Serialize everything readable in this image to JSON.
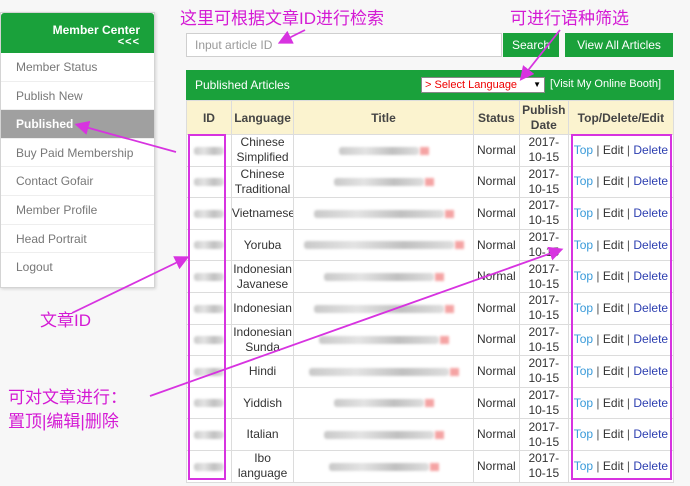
{
  "sidebar": {
    "title": "Member Center",
    "collapse": "<<<",
    "items": [
      {
        "label": "Member Status"
      },
      {
        "label": "Publish New"
      },
      {
        "label": "Published"
      },
      {
        "label": "Buy Paid Membership"
      },
      {
        "label": "Contact Gofair"
      },
      {
        "label": "Member Profile"
      },
      {
        "label": "Head Portrait"
      },
      {
        "label": "Logout"
      }
    ]
  },
  "search": {
    "placeholder": "Input article ID",
    "search_label": "Search",
    "view_all_label": "View All Articles"
  },
  "panel": {
    "title": "Published Articles",
    "language_select": "> Select Language",
    "visit_link": "[Visit My Online Booth]"
  },
  "table": {
    "headers": [
      "ID",
      "Language",
      "Title",
      "Status",
      "Publish Date",
      "Top/Delete/Edit"
    ],
    "rows": [
      {
        "language": "Chinese Simplified",
        "status": "Normal",
        "date": "2017-10-15"
      },
      {
        "language": "Chinese Traditional",
        "status": "Normal",
        "date": "2017-10-15"
      },
      {
        "language": "Vietnamese",
        "status": "Normal",
        "date": "2017-10-15"
      },
      {
        "language": "Yoruba",
        "status": "Normal",
        "date": "2017-10-15"
      },
      {
        "language": "Indonesian Javanese",
        "status": "Normal",
        "date": "2017-10-15"
      },
      {
        "language": "Indonesian",
        "status": "Normal",
        "date": "2017-10-15"
      },
      {
        "language": "Indonesian Sunda",
        "status": "Normal",
        "date": "2017-10-15"
      },
      {
        "language": "Hindi",
        "status": "Normal",
        "date": "2017-10-15"
      },
      {
        "language": "Yiddish",
        "status": "Normal",
        "date": "2017-10-15"
      },
      {
        "language": "Italian",
        "status": "Normal",
        "date": "2017-10-15"
      },
      {
        "language": "Ibo language",
        "status": "Normal",
        "date": "2017-10-15"
      }
    ],
    "actions": {
      "top": "Top",
      "edit": "Edit",
      "delete": "Delete",
      "separator": "|"
    }
  },
  "annotations": {
    "search_note": "这里可根据文章ID进行检索",
    "language_note": "可进行语种筛选",
    "id_note": "文章ID",
    "actions_note_line1": "可对文章进行：",
    "actions_note_line2": "置顶|编辑|删除",
    "color": "#d733e0"
  },
  "colors": {
    "brand_green": "#1aa13b",
    "header_yellow": "#fbf3cf",
    "status_green": "#2fa84f",
    "link_blue": "#3a9ad9"
  }
}
